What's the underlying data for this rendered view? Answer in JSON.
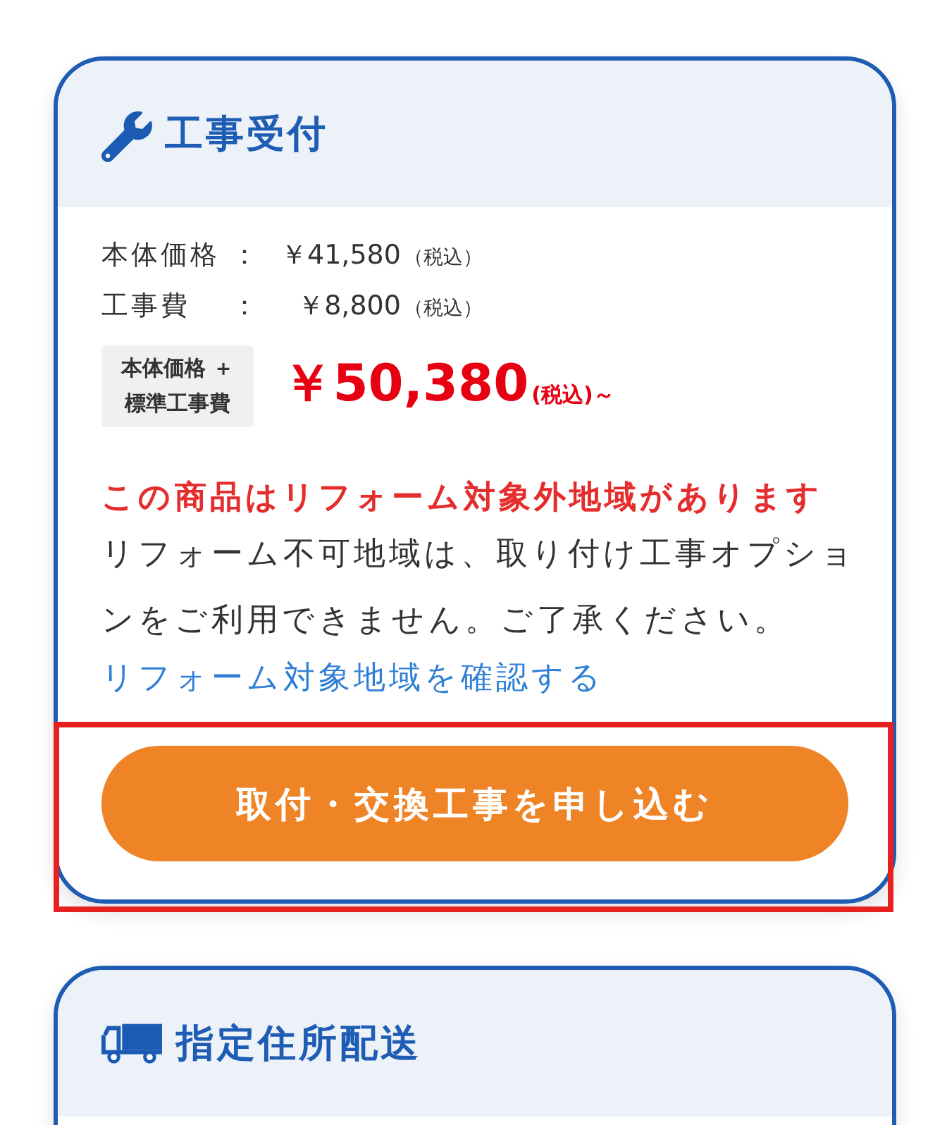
{
  "sections": [
    {
      "kind": "installation",
      "title": "工事受付",
      "price_lines": [
        {
          "label": "本体価格",
          "separator": "：",
          "amount": "￥41,580",
          "tax_note": "（税込）"
        },
        {
          "label": "工事費",
          "separator": "：",
          "amount": "￥8,800",
          "tax_note": "（税込）"
        }
      ],
      "total": {
        "label_lines": [
          "本体価格 ＋",
          "標準工事費"
        ],
        "amount": "￥50,380",
        "suffix": "(税込)～"
      },
      "warning": "この商品はリフォーム対象外地域があります",
      "notice": "リフォーム不可地域は、取り付け工事オプションをご利用できません。ご了承ください。",
      "link": "リフォーム対象地域を確認する",
      "button": {
        "label": "取付・交換工事を申し込む",
        "highlighted": true
      }
    },
    {
      "kind": "delivery",
      "title": "指定住所配送"
    }
  ]
}
